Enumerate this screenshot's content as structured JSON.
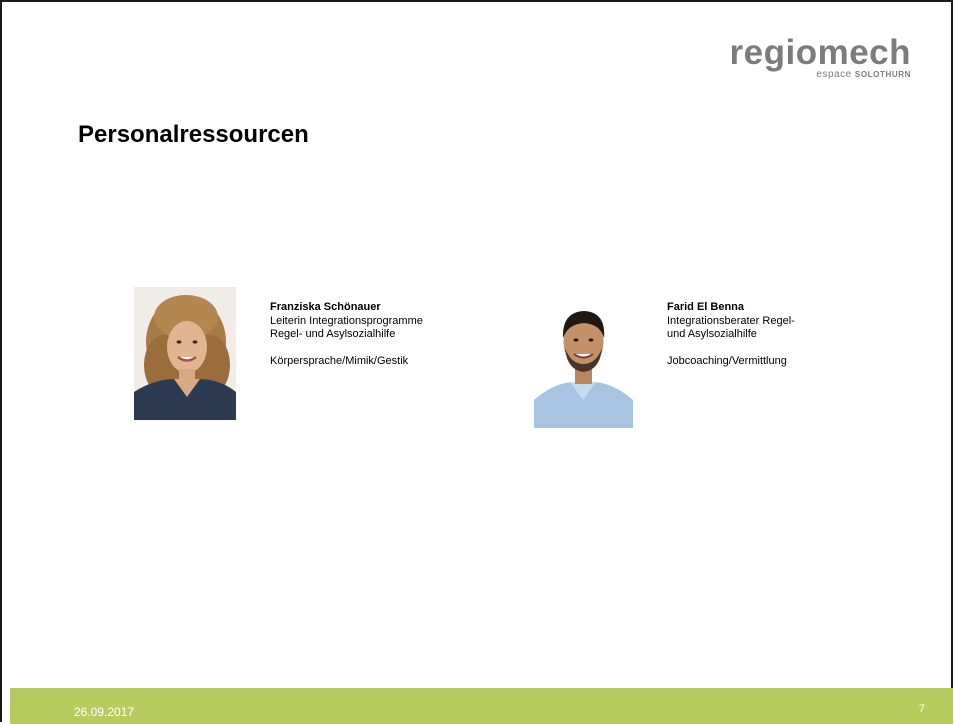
{
  "logo": {
    "name": "regiomech",
    "sub_light": "espace",
    "sub_bold": "SOLOTHURN"
  },
  "slide": {
    "title": "Personalressourcen"
  },
  "people": [
    {
      "name": "Franziska Schönauer",
      "line1": "Leiterin Integrationsprogramme",
      "line2": "Regel- und Asylsozialhilfe",
      "skills": "Körpersprache/Mimik/Gestik"
    },
    {
      "name": "Farid El Benna",
      "line1": "Integrationsberater Regel-",
      "line2": "und Asylsozialhilfe",
      "skills": "Jobcoaching/Vermittlung"
    }
  ],
  "footer": {
    "date": "26.09.2017",
    "page": "7"
  },
  "colors": {
    "footer": "#b7cc5f",
    "logo": "#7c7c7c"
  }
}
